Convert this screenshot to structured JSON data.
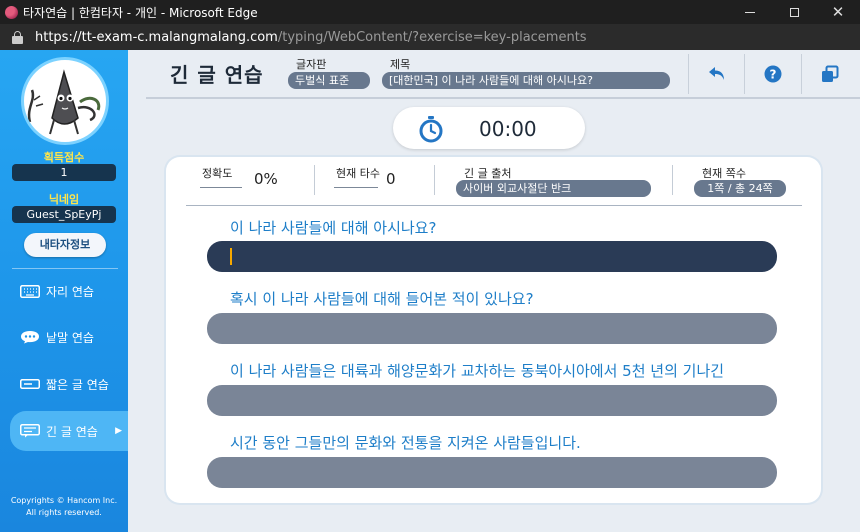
{
  "window": {
    "title": "타자연습 | 한컴타자 - 개인 - Microsoft Edge",
    "url_host": "https://tt-exam-c.malangmalang.com",
    "url_path": "/typing/WebContent/?exercise=key-placements"
  },
  "sidebar": {
    "score_label": "획득점수",
    "score_value": "1",
    "nickname_label": "닉네임",
    "nickname_value": "Guest_SpEyPj",
    "my_info_button": "내타자정보",
    "items": [
      {
        "label": "자리 연습",
        "icon": "keyboard-icon"
      },
      {
        "label": "낱말 연습",
        "icon": "speech-bubble-icon"
      },
      {
        "label": "짧은 글 연습",
        "icon": "short-text-icon"
      },
      {
        "label": "긴 글 연습",
        "icon": "long-text-icon",
        "active": true
      }
    ],
    "copyright_line1": "Copyrights © Hancom Inc.",
    "copyright_line2": "All rights reserved."
  },
  "header": {
    "title": "긴 글 연습",
    "keyboard_label": "글자판",
    "keyboard_value": "두벌식 표준",
    "subject_label": "제목",
    "subject_value": "[대한민국] 이 나라 사람들에 대해 아시나요?",
    "icons": [
      "back-arrow-icon",
      "help-icon",
      "window-icon"
    ]
  },
  "timer": {
    "value": "00:00"
  },
  "stats": {
    "accuracy_label": "정확도",
    "accuracy_value": "0%",
    "speed_label": "현재 타수",
    "speed_value": "0",
    "source_label": "긴 글 출처",
    "source_value": "사이버 외교사절단 반크",
    "page_label": "현재 쪽수",
    "page_value": "1쪽 / 총 24쪽"
  },
  "lines": [
    {
      "text": "이 나라 사람들에 대해 아시나요?",
      "typed": ""
    },
    {
      "text": "혹시 이 나라 사람들에 대해 들어본 적이 있나요?",
      "typed": ""
    },
    {
      "text": "이 나라 사람들은 대륙과 해양문화가 교차하는 동북아시아에서 5천 년의 기나긴",
      "typed": ""
    },
    {
      "text": "시간 동안 그들만의 문화와 전통을 지켜온 사람들입니다.",
      "typed": ""
    }
  ],
  "colors": {
    "sidebar_blue": "#1e96ea",
    "score_yellow": "#ffe54a",
    "sentence_blue": "#1e7ec8",
    "active_input": "#2a3b56",
    "inactive_input": "#7a8597",
    "caret_orange": "#f6a800"
  }
}
